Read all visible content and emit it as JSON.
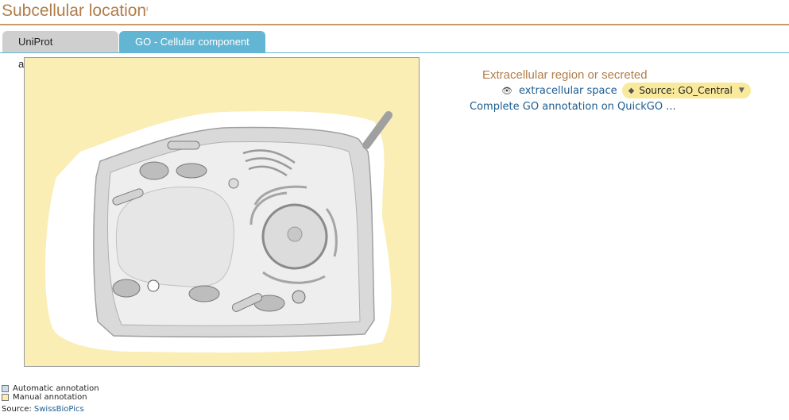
{
  "header": {
    "title": "Subcellular location",
    "info_mark": "i"
  },
  "tabs": [
    {
      "label": "UniProt annotation",
      "active": false
    },
    {
      "label": "GO - Cellular component",
      "active": true
    }
  ],
  "location": {
    "group_title": "Extracellular region or secreted",
    "items": [
      {
        "icon": "eye-icon",
        "label": "extracellular space",
        "source_label": "Source: GO_Central"
      }
    ],
    "complete_link": "Complete GO annotation on QuickGO ..."
  },
  "legend": {
    "automatic": "Automatic annotation",
    "manual": "Manual annotation"
  },
  "source": {
    "prefix": "Source:",
    "link": "SwissBioPics"
  },
  "colors": {
    "accent": "#b07d4a",
    "tab_active": "#62b5d3",
    "tab_inactive": "#cfcfcf",
    "link": "#1c5c8f",
    "manual_highlight": "#faeeb5",
    "automatic_highlight": "#c9dff1"
  }
}
